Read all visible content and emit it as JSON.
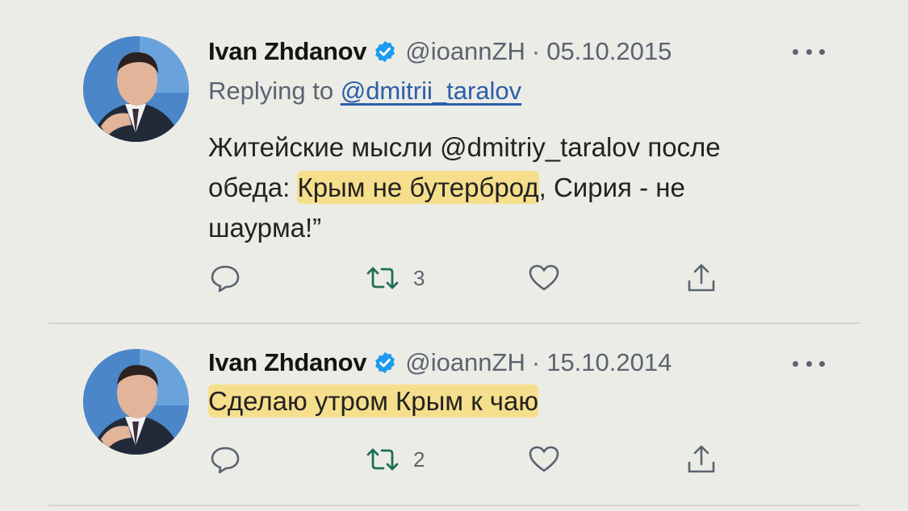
{
  "tweets": [
    {
      "author_name": "Ivan Zhdanov",
      "handle": "@ioannZH",
      "separator": "·",
      "date": "05.10.2015",
      "replying_to_prefix": "Replying to ",
      "replying_to_handle": "@dmitrii_taralov",
      "text_lines": [
        {
          "pre": "Житейские мысли @dmitriy_taralov после",
          "hl": "",
          "post": ""
        },
        {
          "pre": "обеда:  ",
          "hl": "Крым не бутерброд",
          "post": ", Сирия - не"
        },
        {
          "pre": "шаурма!”",
          "hl": "",
          "post": ""
        }
      ],
      "retweet_count": "3",
      "icons": [
        "verified-badge-icon",
        "more-icon",
        "reply-icon",
        "retweet-icon",
        "like-icon",
        "share-icon"
      ]
    },
    {
      "author_name": "Ivan Zhdanov",
      "handle": "@ioannZH",
      "separator": "·",
      "date": "15.10.2014",
      "text_lines": [
        {
          "pre": "",
          "hl": "Сделаю утром Крым к чаю",
          "post": ""
        }
      ],
      "retweet_count": "2",
      "icons": [
        "verified-badge-icon",
        "more-icon",
        "reply-icon",
        "retweet-icon",
        "like-icon",
        "share-icon"
      ]
    }
  ],
  "colors": {
    "background": "#ecece6",
    "verified": "#1d9bf0",
    "highlight": "#fadb6e",
    "link": "#2a5fa8",
    "muted": "#5a6470"
  }
}
